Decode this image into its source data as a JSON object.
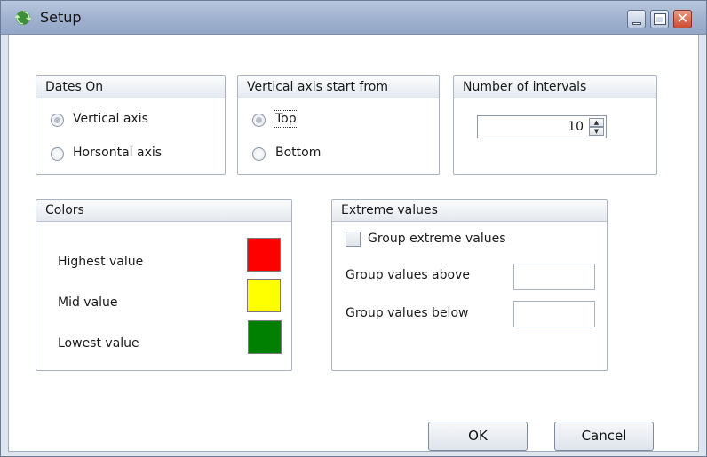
{
  "window": {
    "title": "Setup"
  },
  "dates_on": {
    "title": "Dates On",
    "options": [
      {
        "label": "Vertical axis",
        "checked": true
      },
      {
        "label": "Horsontal axis",
        "checked": false
      }
    ]
  },
  "vertical_axis": {
    "title": "Vertical axis start from",
    "options": [
      {
        "label": "Top",
        "checked": true
      },
      {
        "label": "Bottom",
        "checked": false
      }
    ]
  },
  "intervals": {
    "title": "Number of intervals",
    "value": "10"
  },
  "colors": {
    "title": "Colors",
    "rows": [
      {
        "label": "Highest value",
        "color": "#ff0000"
      },
      {
        "label": "Mid value",
        "color": "#ffff00"
      },
      {
        "label": "Lowest value",
        "color": "#008000"
      }
    ]
  },
  "extreme": {
    "title": "Extreme values",
    "checkbox_label": "Group extreme values",
    "checked": false,
    "above_label": "Group values above",
    "above_value": "",
    "below_label": "Group values below",
    "below_value": ""
  },
  "buttons": {
    "ok": "OK",
    "cancel": "Cancel"
  }
}
